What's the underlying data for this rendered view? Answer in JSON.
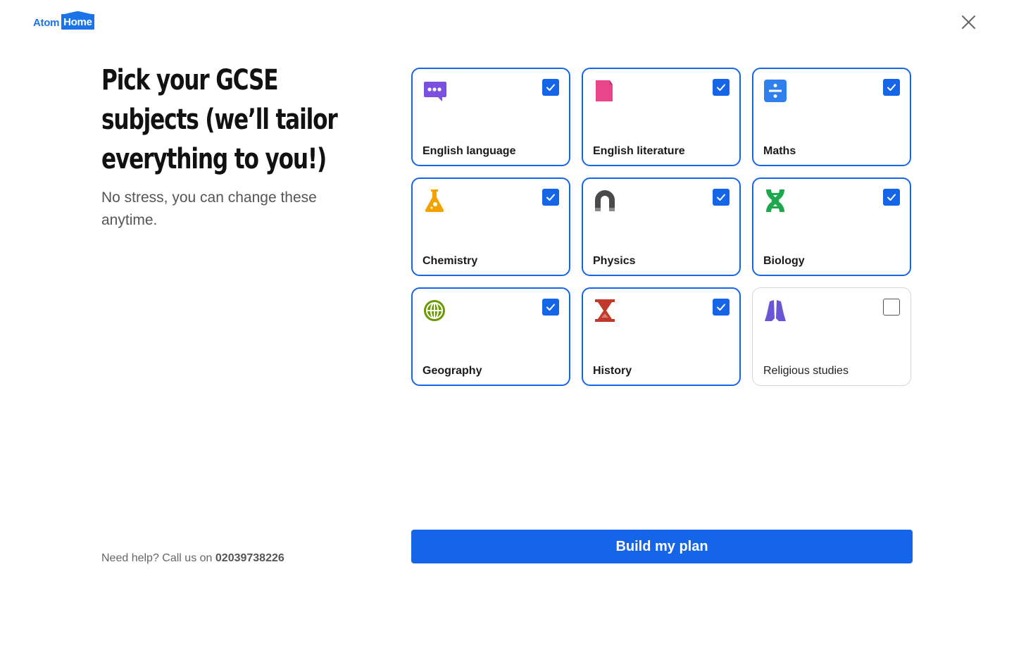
{
  "brand": {
    "part1": "Atom",
    "part2": "Home"
  },
  "close_icon": "close-icon",
  "heading": {
    "line1": "Pick your GCSE",
    "line2": "subjects (we’ll tailor",
    "line3": "everything to you!)"
  },
  "subtitle": "No stress, you can change these anytime.",
  "subjects": [
    {
      "label": "English language",
      "icon": "speech-bubble-icon",
      "color": "#7b4fe0",
      "checked": true
    },
    {
      "label": "English literature",
      "icon": "book-icon",
      "color": "#e8458b",
      "checked": true
    },
    {
      "label": "Maths",
      "icon": "divide-icon",
      "color": "#2f80ed",
      "checked": true
    },
    {
      "label": "Chemistry",
      "icon": "flask-icon",
      "color": "#f4a200",
      "checked": true
    },
    {
      "label": "Physics",
      "icon": "magnet-icon",
      "color": "#4a4a4a",
      "checked": true
    },
    {
      "label": "Biology",
      "icon": "dna-icon",
      "color": "#1da84e",
      "checked": true
    },
    {
      "label": "Geography",
      "icon": "globe-icon",
      "color": "#6a9a00",
      "checked": true
    },
    {
      "label": "History",
      "icon": "hourglass-icon",
      "color": "#c0392b",
      "checked": true
    },
    {
      "label": "Religious studies",
      "icon": "praying-hands-icon",
      "color": "#6b54d6",
      "checked": false
    }
  ],
  "help": {
    "prefix": "Need help? Call us on ",
    "phone": "02039738226"
  },
  "cta": {
    "label": "Build my plan"
  },
  "colors": {
    "accent": "#1565e8",
    "border_unchecked": "#d6d6d6"
  }
}
